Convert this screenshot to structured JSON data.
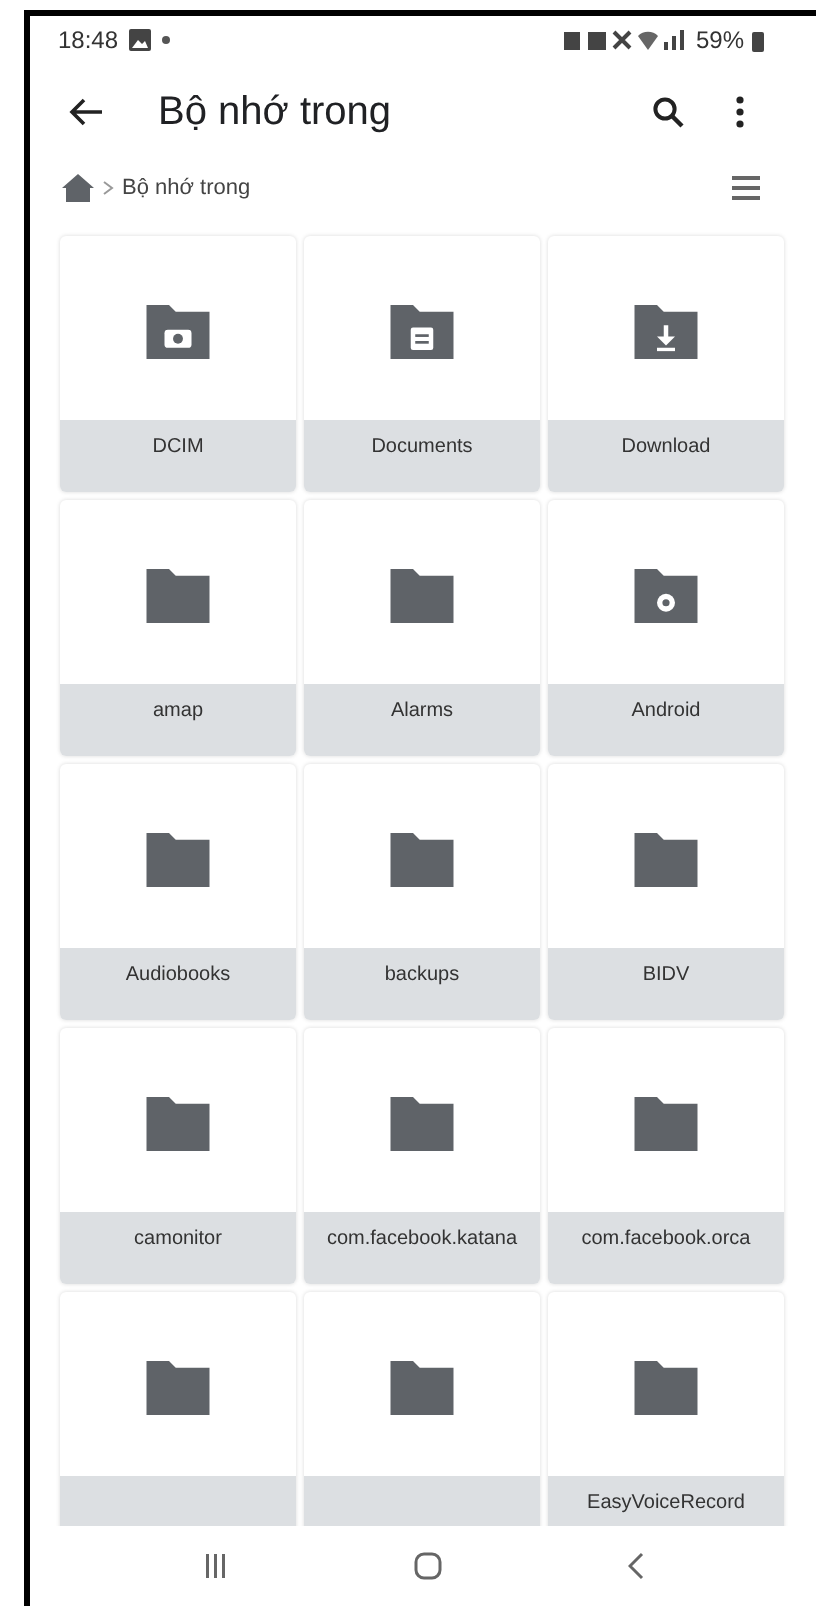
{
  "status_bar": {
    "time": "18:48",
    "battery": "59%"
  },
  "app_bar": {
    "title": "Bộ nhớ trong"
  },
  "breadcrumb": {
    "path": [
      "Bộ nhớ trong"
    ]
  },
  "folders": [
    {
      "kind": "camera",
      "name": "DCIM"
    },
    {
      "kind": "document",
      "name": "Documents"
    },
    {
      "kind": "download",
      "name": "Download"
    },
    {
      "kind": "plain",
      "name": "amap"
    },
    {
      "kind": "plain",
      "name": "Alarms"
    },
    {
      "kind": "gear",
      "name": "Android"
    },
    {
      "kind": "plain",
      "name": "Audiobooks"
    },
    {
      "kind": "plain",
      "name": "backups"
    },
    {
      "kind": "plain",
      "name": "BIDV"
    },
    {
      "kind": "plain",
      "name": "camonitor"
    },
    {
      "kind": "plain",
      "name": "com.facebook.katana"
    },
    {
      "kind": "plain",
      "name": "com.facebook.orca"
    },
    {
      "kind": "plain"
    },
    {
      "kind": "plain"
    },
    {
      "kind": "plain",
      "name": "EasyVoiceRecord"
    }
  ]
}
